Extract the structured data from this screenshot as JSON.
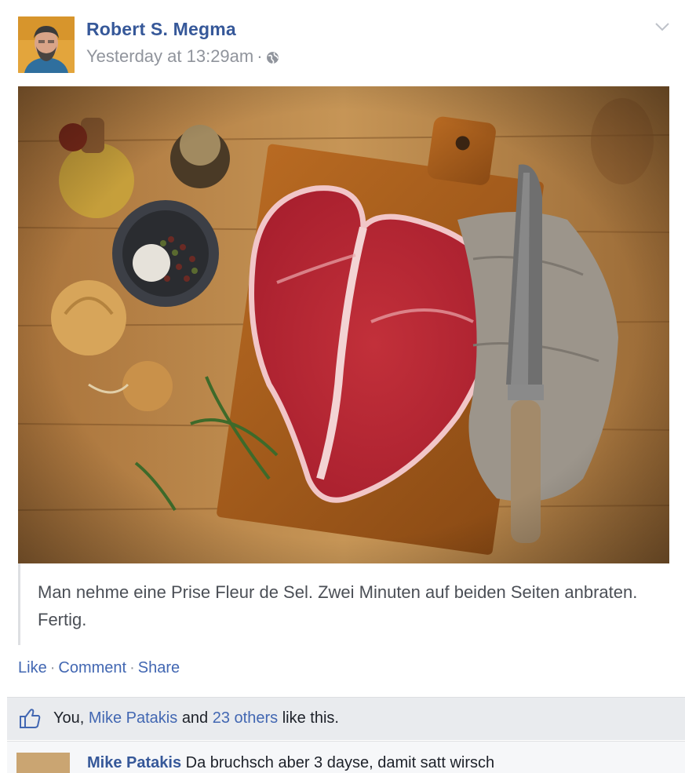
{
  "post": {
    "author": "Robert S. Megma",
    "timestamp": "Yesterday at 13:29am",
    "privacy_icon": "globe-icon",
    "caption": "Man nehme eine Prise Fleur de Sel. Zwei Minuten auf beiden Seiten anbraten. Fertig."
  },
  "actions": {
    "like": "Like",
    "comment": "Comment",
    "share": "Share",
    "separator": "·"
  },
  "likes": {
    "you": "You,",
    "friend": "Mike Patakis",
    "and": "and",
    "others": "23 others",
    "suffix": "like this."
  },
  "comment": {
    "author": "Mike Patakis",
    "text": "Da bruchsch aber 3 dayse, damit satt wirsch"
  },
  "colors": {
    "link": "#365899",
    "muted": "#90949c",
    "likes_bg": "#e9ebee"
  }
}
